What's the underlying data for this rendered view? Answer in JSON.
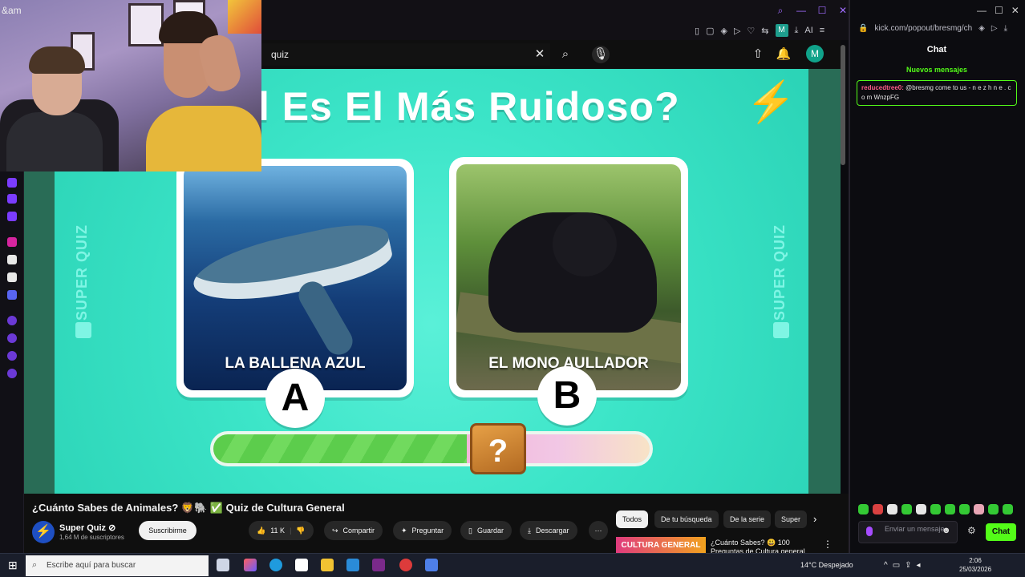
{
  "webcam": {
    "label": "&am"
  },
  "youtube": {
    "search_value": "quiz",
    "avatar_letter": "M",
    "video": {
      "question": "l Es El Más Ruidoso?",
      "side_label": "SUPER QUIZ",
      "option_a": {
        "letter": "A",
        "caption": "LA BALLENA AZUL"
      },
      "option_b": {
        "letter": "B",
        "caption": "EL MONO AULLADOR"
      },
      "progress": 0.58,
      "mystery_box": "?"
    },
    "title": "¿Cuánto Sabes de Animales? 🦁🐘 ✅ Quiz de Cultura General",
    "channel": {
      "name": "Super Quiz ⊘",
      "subs": "1,64 M de suscriptores",
      "logo": "⚡"
    },
    "subscribe_label": "Suscribirme",
    "actions": {
      "likes": "11 K",
      "share": "Compartir",
      "ask": "Preguntar",
      "save": "Guardar",
      "download": "Descargar"
    },
    "chips": [
      "Todos",
      "De tu búsqueda",
      "De la serie",
      "Super"
    ],
    "recommended": {
      "thumb_text": "CULTURA GENERAL",
      "title": "¿Cuánto Sabes? 😃 100 Preguntas de Cultura general"
    }
  },
  "chat": {
    "url": "kick.com/popout/bresmg/ch",
    "title": "Chat",
    "new_messages": "Nuevos mensajes",
    "message": {
      "user": "reducedtree0:",
      "text": "@bresmg come to us - n e z h n e . c o m WnzpFG"
    },
    "input_placeholder": "Enviar un mensaje",
    "send_label": "Chat"
  },
  "taskbar": {
    "search_placeholder": "Escribe aquí para buscar",
    "weather": "14°C  Despejado",
    "time": "2:06",
    "date": "25/03/2026"
  },
  "colors": {
    "kick_green": "#53fc18",
    "quiz_teal": "#3ce5c8",
    "accent_purple": "#a06cff"
  }
}
